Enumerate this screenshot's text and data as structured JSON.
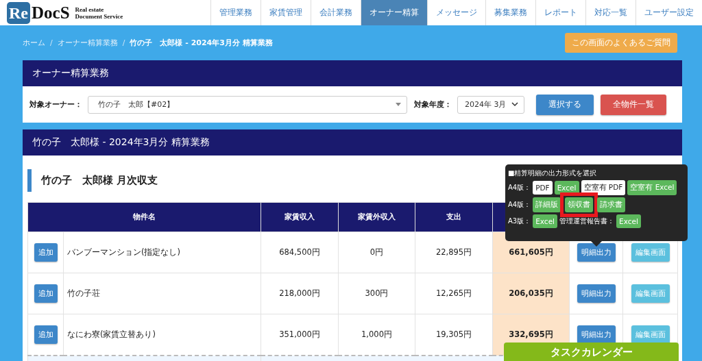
{
  "logo": {
    "mark_1": "Re",
    "mark_2": "DocS",
    "tagline_1": "Real estate",
    "tagline_2": "Document Service"
  },
  "nav": [
    {
      "label": "管理業務",
      "selected": false
    },
    {
      "label": "家賃管理",
      "selected": false
    },
    {
      "label": "会計業務",
      "selected": false
    },
    {
      "label": "オーナー精算",
      "selected": true
    },
    {
      "label": "メッセージ",
      "selected": false
    },
    {
      "label": "募集業務",
      "selected": false
    },
    {
      "label": "レポート",
      "selected": false
    },
    {
      "label": "対応一覧",
      "selected": false
    },
    {
      "label": "ユーザー設定",
      "selected": false
    }
  ],
  "breadcrumb": [
    {
      "label": "ホーム",
      "current": false
    },
    {
      "separator": "/",
      "label": "オーナー精算業務",
      "current": false
    },
    {
      "separator": "/",
      "label": "竹の子　太郎様 - 2024年3月分 精算業務",
      "current": true
    }
  ],
  "faq_button": "この画面のよくあるご質問",
  "owner_panel": {
    "title": "オーナー精算業務",
    "owner_label": "対象オーナー：",
    "owner_value": "竹の子　太郎【#02】",
    "year_label": "対象年度：",
    "year_value": "2024年 3月",
    "select_button": "選択する",
    "all_button": "全物件一覧"
  },
  "settlement_panel": {
    "title": "竹の子　太郎様 - 2024年3月分 精算業務",
    "section_title": "竹の子　太郎様 月次収支"
  },
  "table": {
    "columns": [
      "物件名",
      "家賃収入",
      "家賃外収入",
      "支出"
    ],
    "rows": [
      {
        "add": "追加",
        "name": "バンブーマンション(指定なし)",
        "rent": "684,500円",
        "other": "0円",
        "expense": "22,895円",
        "balance": "661,605円",
        "detail": "明細出力",
        "edit": "編集画面"
      },
      {
        "add": "追加",
        "name": "竹の子荘",
        "rent": "218,000円",
        "other": "300円",
        "expense": "12,265円",
        "balance": "206,035円",
        "detail": "明細出力",
        "edit": "編集画面"
      },
      {
        "add": "追加",
        "name": "なにわ寮(家賃立替あり)",
        "rent": "351,000円",
        "other": "1,000円",
        "expense": "19,305円",
        "balance": "332,695円",
        "detail": "明細出力",
        "edit": "編集画面"
      }
    ]
  },
  "popover": {
    "title": "■精算明細の出力形式を選択",
    "rows": [
      {
        "items": [
          {
            "kind": "label",
            "text": "A4版："
          },
          {
            "kind": "light",
            "text": "PDF",
            "highlighted": false
          },
          {
            "kind": "green",
            "text": "Excel",
            "highlighted": false
          },
          {
            "kind": "light",
            "text": "空室有 PDF",
            "highlighted": false
          },
          {
            "kind": "green",
            "text": "空室有 Excel",
            "highlighted": false
          }
        ]
      },
      {
        "items": [
          {
            "kind": "label",
            "text": "A4版："
          },
          {
            "kind": "green",
            "text": "詳細版",
            "highlighted": false
          },
          {
            "kind": "green",
            "text": "領収書",
            "highlighted": true
          },
          {
            "kind": "green",
            "text": "請求書",
            "highlighted": false
          }
        ]
      },
      {
        "items": [
          {
            "kind": "label",
            "text": "A3版："
          },
          {
            "kind": "green",
            "text": "Excel",
            "highlighted": false
          },
          {
            "kind": "label",
            "text": "管理運営報告書："
          },
          {
            "kind": "green",
            "text": "Excel",
            "highlighted": false
          }
        ]
      }
    ]
  },
  "task_calendar_button": "タスクカレンダー"
}
